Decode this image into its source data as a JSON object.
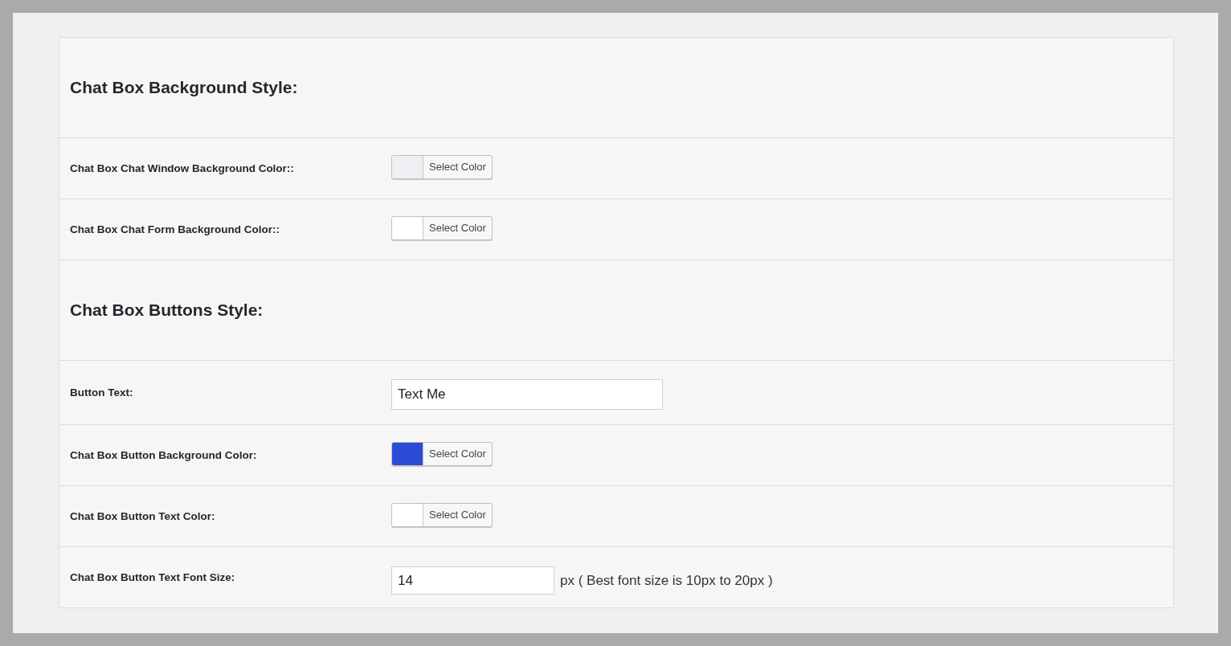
{
  "rows": [
    {
      "kind": "heading",
      "title": "Chat Box Background Style:"
    },
    {
      "kind": "color",
      "label": "Chat Box Chat Window Background Color::",
      "color": "#eeeff2",
      "button": "Select Color"
    },
    {
      "kind": "color",
      "label": "Chat Box Chat Form Background Color::",
      "color": "#ffffff",
      "button": "Select Color"
    },
    {
      "kind": "heading",
      "title": "Chat Box Buttons Style:"
    },
    {
      "kind": "text",
      "label": "Button Text:",
      "value": "Text Me"
    },
    {
      "kind": "color",
      "label": "Chat Box Button Background Color:",
      "color": "#2b4bd4",
      "button": "Select Color"
    },
    {
      "kind": "color",
      "label": "Chat Box Button Text Color:",
      "color": "#ffffff",
      "button": "Select Color"
    },
    {
      "kind": "number",
      "label": "Chat Box Button Text Font Size:",
      "value": "14",
      "hint": "px ( Best font size is 10px to 20px )"
    }
  ]
}
